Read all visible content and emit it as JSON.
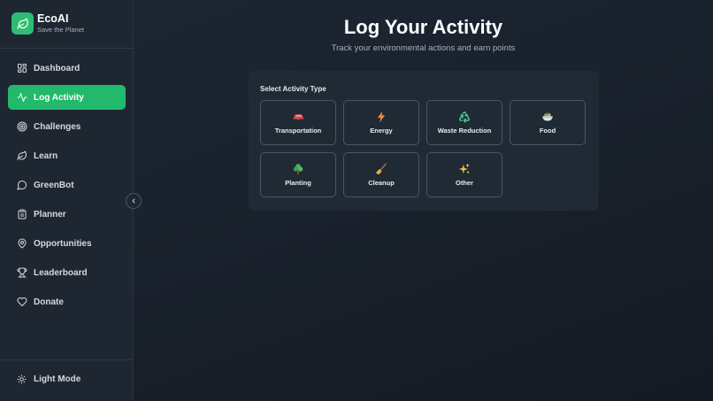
{
  "brand": {
    "name": "EcoAI",
    "tagline": "Save the Planet",
    "accent": "#22b96c"
  },
  "nav": {
    "items": [
      {
        "label": "Dashboard",
        "icon": "grid-icon",
        "active": false
      },
      {
        "label": "Log Activity",
        "icon": "activity-icon",
        "active": true
      },
      {
        "label": "Challenges",
        "icon": "target-icon",
        "active": false
      },
      {
        "label": "Learn",
        "icon": "leaf-icon",
        "active": false
      },
      {
        "label": "GreenBot",
        "icon": "chat-bubble-icon",
        "active": false
      },
      {
        "label": "Planner",
        "icon": "clipboard-icon",
        "active": false
      },
      {
        "label": "Opportunities",
        "icon": "map-pin-icon",
        "active": false
      },
      {
        "label": "Leaderboard",
        "icon": "trophy-icon",
        "active": false
      },
      {
        "label": "Donate",
        "icon": "heart-icon",
        "active": false
      }
    ],
    "light_mode_label": "Light Mode"
  },
  "page": {
    "title": "Log Your Activity",
    "subtitle": "Track your environmental actions and earn points"
  },
  "activity": {
    "section_label": "Select Activity Type",
    "types": [
      {
        "label": "Transportation",
        "icon": "car-icon"
      },
      {
        "label": "Energy",
        "icon": "lightning-icon"
      },
      {
        "label": "Waste Reduction",
        "icon": "recycle-icon"
      },
      {
        "label": "Food",
        "icon": "food-bowl-icon"
      },
      {
        "label": "Planting",
        "icon": "tree-icon"
      },
      {
        "label": "Cleanup",
        "icon": "broom-icon"
      },
      {
        "label": "Other",
        "icon": "sparkles-icon"
      }
    ]
  }
}
